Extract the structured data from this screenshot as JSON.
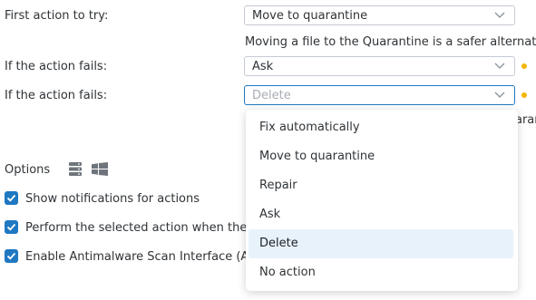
{
  "rows": [
    {
      "label": "First action to try:",
      "value": "Move to quarantine"
    },
    {
      "label": "If the action fails:",
      "value": "Ask"
    },
    {
      "label": "If the action fails:",
      "placeholder": "Delete"
    }
  ],
  "description": "Moving a file to the Quarantine is a safer alternative",
  "partial_text": "arant",
  "options": {
    "title": "Options",
    "items": [
      {
        "label": "Show notifications for actions",
        "checked": true
      },
      {
        "label": "Perform the selected action when the",
        "checked": true
      },
      {
        "label": "Enable Antimalware Scan Interface (A",
        "checked": true
      }
    ]
  },
  "dropdown": {
    "items": [
      "Fix automatically",
      "Move to quarantine",
      "Repair",
      "Ask",
      "Delete",
      "No action"
    ],
    "highlighted": "Delete"
  },
  "icons": {
    "server": "server-icon",
    "windows": "windows-icon",
    "chevron": "chevron-down-icon",
    "checkmark": "checkmark-icon"
  },
  "colors": {
    "accent": "#1f78c1",
    "warning_dot": "#f5b400",
    "highlight": "#e8f2fb"
  }
}
